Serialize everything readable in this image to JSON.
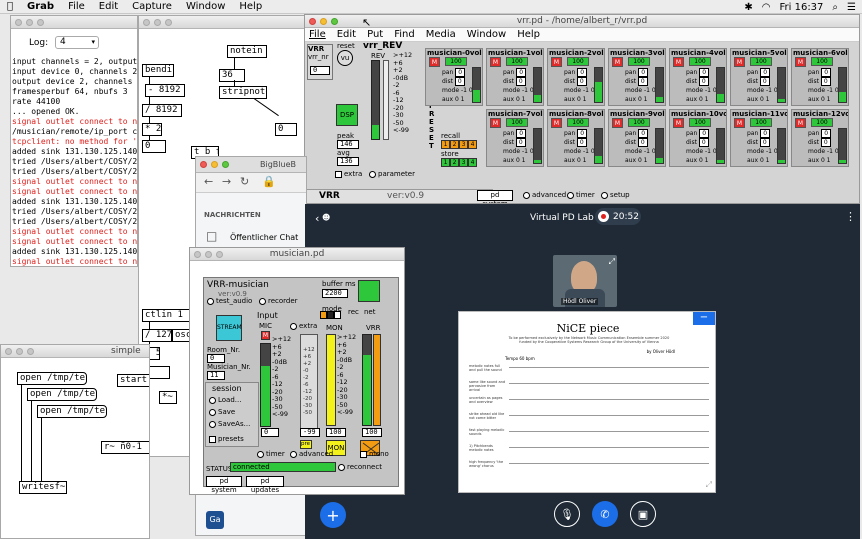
{
  "menubar": {
    "app": "Grab",
    "items": [
      "File",
      "Edit",
      "Capture",
      "Window",
      "Help"
    ],
    "clock": "Fri 16:37"
  },
  "console": {
    "log_label": "Log:",
    "log_value": "4",
    "lines": [
      {
        "text": "input channels = 2, output channels = ",
        "error": false
      },
      {
        "text": "input device 0, channels 2",
        "error": false
      },
      {
        "text": "output device 2, channels 2",
        "error": false
      },
      {
        "text": "framesperbuf 64, nbufs 3",
        "error": false
      },
      {
        "text": "rate 44100",
        "error": false
      },
      {
        "text": "... opened OK.",
        "error": false
      },
      {
        "text": "signal outlet connect to nonsignal inl",
        "error": true
      },
      {
        "text": "/musician/remote/ip_port connect to:",
        "error": false
      },
      {
        "text": "tcpclient: no method for 'timeout'",
        "error": true
      },
      {
        "text": "added sink 131.130.125.140 63111 11",
        "error": false
      },
      {
        "text": "tried /Users/albert/COSY/20S_NCE/s",
        "error": false
      },
      {
        "text": "tried /Users/albert/COSY/20S_NCE/s",
        "error": false
      },
      {
        "text": "signal outlet connect to nonsignal inl",
        "error": true
      },
      {
        "text": "signal outlet connect to nonsignal inl",
        "error": true
      },
      {
        "text": "added sink 131.130.125.140 63111 11",
        "error": false
      },
      {
        "text": "tried /Users/albert/COSY/20S_NCE/s",
        "error": false
      },
      {
        "text": "tried /Users/albert/COSY/20S_NCE/s",
        "error": false
      },
      {
        "text": "signal outlet connect to nonsignal inl",
        "error": true
      },
      {
        "text": "signal outlet connect to nonsignal inl",
        "error": true
      },
      {
        "text": "added sink 131.130.125.140 63111 11",
        "error": false
      },
      {
        "text": "signal outlet connect to nonsignal inl",
        "error": true
      },
      {
        "text": "signal outlet connect to nonsignal inl",
        "error": true
      }
    ]
  },
  "patch_middle": {
    "notein": "notein 1",
    "bendin": "bendin",
    "num36": "36",
    "minus8192": "- 8192",
    "stripnote": "stripnote",
    "div8192": "/ 8192",
    "mul2": "* 2",
    "zero": "0",
    "zero2": "0",
    "t_b_f": "t b f",
    "ctlin": "ctlin 1 1",
    "div127": "/ 127",
    "osc": "osc~",
    "mul5": "* 5",
    "zero3": "0",
    "star": "*~"
  },
  "simple_patch": {
    "title": "simple",
    "msg1": "open /tmp/test1",
    "msg2": "open /tmp/test2",
    "msg3": "open /tmp/test3",
    "start": "start",
    "writesf": "writesf~ 2",
    "r_obj": "r~ ñ0-1"
  },
  "vrr_window": {
    "title": "vrr.pd - /home/albert_r/vrr.pd",
    "menu": [
      "File",
      "Edit",
      "Put",
      "Find",
      "Media",
      "Window",
      "Help"
    ],
    "vrr_label": "VRR",
    "vrr_nr": "vrr_nr",
    "vrr_nr_val": "0",
    "reset": "reset",
    "vu": "vu",
    "vrr_rev": "vrr_REV",
    "rev": "REV",
    "dsp": "DSP",
    "peak": "peak",
    "peak_val": "146",
    "avg": "avg",
    "avg_val": "136",
    "extra": "extra",
    "parameter": "parameter",
    "db_scale": [
      ">+12",
      "+6",
      "+2",
      "-0dB",
      "-2",
      "-6",
      "-12",
      "-20",
      "-30",
      "-50",
      "<-99"
    ],
    "preset": "PRESET",
    "recall": "recall",
    "store": "store",
    "preset_nums": [
      "1",
      "2",
      "3",
      "4"
    ],
    "bottom_vrr": "VRR",
    "version": "ver:v0.9",
    "pd_system": "pd system",
    "advanced": "advanced",
    "timer": "timer",
    "setup": "setup",
    "musicians": [
      {
        "name": "musician-0vol",
        "vol": "100",
        "pan": "0",
        "dist": "0",
        "level": 0.35
      },
      {
        "name": "musician-1vol",
        "vol": "100",
        "pan": "0",
        "dist": "0",
        "level": 0.2
      },
      {
        "name": "musician-2vol",
        "vol": "100",
        "pan": "0",
        "dist": "0",
        "level": 0.6
      },
      {
        "name": "musician-3vol",
        "vol": "100",
        "pan": "0",
        "dist": "0",
        "level": 0.15
      },
      {
        "name": "musician-4vol",
        "vol": "100",
        "pan": "0",
        "dist": "0",
        "level": 0.25
      },
      {
        "name": "musician-5vol",
        "vol": "100",
        "pan": "0",
        "dist": "0",
        "level": 0.1
      },
      {
        "name": "musician-6vol",
        "vol": "100",
        "pan": "0",
        "dist": "0",
        "level": 0.3
      },
      {
        "name": "musician-7vol",
        "vol": "100",
        "pan": "0",
        "dist": "0",
        "level": 0.1
      },
      {
        "name": "musician-8vol",
        "vol": "100",
        "pan": "0",
        "dist": "0",
        "level": 0.2
      },
      {
        "name": "musician-9vol",
        "vol": "100",
        "pan": "0",
        "dist": "0",
        "level": 0.15
      },
      {
        "name": "musician-10vol",
        "vol": "100",
        "pan": "0",
        "dist": "0",
        "level": 0.1
      },
      {
        "name": "musician-11vol",
        "vol": "100",
        "pan": "0",
        "dist": "0",
        "level": 0.1
      },
      {
        "name": "musician-12vol",
        "vol": "100",
        "pan": "0",
        "dist": "0",
        "level": 0.1
      }
    ],
    "row_labels": {
      "pan": "pan",
      "dist": "dist",
      "mode": "mode",
      "aux": "aux",
      "mode_vals": "-1 0 1",
      "aux_vals": "0 1"
    }
  },
  "browser": {
    "tab_title": "BigBlueB",
    "nachrichten": "NACHRICHTEN",
    "chat": "Öffentlicher Chat",
    "user_initials": "Ga"
  },
  "bbb": {
    "title": "Virtual PD Lab",
    "timer": "20:52",
    "speaker": "Hödl Oliver",
    "doc_title": "NiCE piece",
    "doc_subtitle1": "To be performed exclusively by the Network Music Communication Ensemble summer 2020",
    "doc_subtitle2": "funded by the Cooperative Systems Research Group of the University of Vienna",
    "doc_author": "by Oliver Hödl",
    "doc_tempo": "Tempo 60 bpm",
    "doc_notes": [
      "melodic notes full and pull the sound",
      "same like sound and pervasive from arrival",
      "uncertain as pages and overview",
      "strike ahead old like not come bitter",
      "fast playing melodic sounds",
      "1) Pitchbends melodic notes",
      "high frequency 'the wrong' chorus"
    ]
  },
  "musician_window": {
    "title": "musician.pd",
    "header": "VRR-musician",
    "version": "ver:v0.9",
    "buffer": "buffer ms",
    "buffer_val": "2200",
    "net": "net",
    "test_audio": "test_audio",
    "recorder": "recorder",
    "mode": "mode",
    "rec": "rec",
    "stream": "STREAM",
    "room_nr": "Room_Nr.",
    "room_val": "0",
    "musician_nr": "Musician_Nr.",
    "musician_val": "11",
    "input": "Input",
    "mic": "MIC",
    "extra": "extra",
    "mon": "MON",
    "vrr": "VRR",
    "session": "session",
    "load": "Load...",
    "save": "Save",
    "saveas": "SaveAs...",
    "presets": "presets",
    "timer": "timer",
    "advanced": "advanced",
    "mono": "mono",
    "status": "STATUS",
    "status_val": "connected",
    "reconnect": "reconnect",
    "pd_system": "pd system",
    "pd_updates": "pd updates",
    "mic_val": "0",
    "extra_val": "-99",
    "mon_val": "100",
    "vrr_val": "100",
    "db_scale": [
      ">+12",
      "+6",
      "+2",
      "-0dB",
      "-2",
      "-6",
      "-12",
      "-20",
      "-30",
      "-50",
      "<-99"
    ],
    "pre": "pre"
  },
  "colors": {
    "green": "#2ec63a",
    "red": "#e02b2b",
    "orange": "#f39c12",
    "yellow": "#f4f21b",
    "bbb_blue": "#1c6ee8",
    "bbb_bg": "#1f2a36"
  }
}
